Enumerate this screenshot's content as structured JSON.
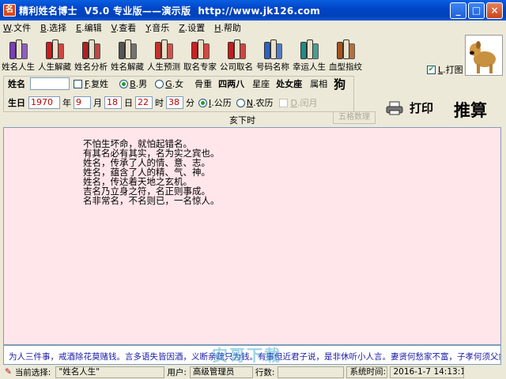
{
  "window": {
    "title": "精利姓名博士  V5.0 专业版——演示版  http://www.jk126.com",
    "minimize": "_",
    "maximize": "□",
    "close": "×"
  },
  "menu": [
    {
      "key": "W",
      "label": "文件"
    },
    {
      "key": "B",
      "label": "选择"
    },
    {
      "key": "E",
      "label": "编辑"
    },
    {
      "key": "V",
      "label": "查看"
    },
    {
      "key": "Y",
      "label": "音乐"
    },
    {
      "key": "Z",
      "label": "设置"
    },
    {
      "key": "H",
      "label": "帮助"
    }
  ],
  "toolbar": [
    {
      "label": "姓名人生",
      "icon": "books-icon",
      "color": "#7a3fb5"
    },
    {
      "label": "人生解藏",
      "icon": "red-book-icon",
      "color": "#c81f1f"
    },
    {
      "label": "姓名分析",
      "icon": "open-book-icon",
      "color": "#b52020"
    },
    {
      "label": "姓名解藏",
      "icon": "book-stack-icon",
      "color": "#555555"
    },
    {
      "label": "人生预测",
      "icon": "color-books-icon",
      "color": "#c9302c"
    },
    {
      "label": "取名专家",
      "icon": "red-books-icon",
      "color": "#d02020"
    },
    {
      "label": "公司取名",
      "icon": "book-red-icon",
      "color": "#c41d1d"
    },
    {
      "label": "号码名称",
      "icon": "blue-books-icon",
      "color": "#2b62c4"
    },
    {
      "label": "幸运人生",
      "icon": "teal-book-icon",
      "color": "#1f8c85"
    },
    {
      "label": "血型指纹",
      "icon": "brown-book-icon",
      "color": "#a8521c"
    }
  ],
  "print_option": {
    "key": "L",
    "label": "打图",
    "checked": true
  },
  "form": {
    "name_label": "姓名",
    "name_value": "",
    "compound_key": "F",
    "compound_label": "复姓",
    "male_key": "B",
    "male_label": "男",
    "female_key": "G",
    "female_label": "女",
    "bone_weight_label": "骨重",
    "bone_weight_value": "四两八",
    "constellation_label": "星座",
    "constellation_value": "处女座",
    "zodiac_label": "属相",
    "zodiac_value": "狗",
    "birthday_label": "生日",
    "year": "1970",
    "year_unit": "年",
    "month": "9",
    "month_unit": "月",
    "day": "18",
    "day_unit": "日",
    "hour": "22",
    "hour_unit": "时",
    "minute": "38",
    "minute_unit": "分",
    "solar_key": "I",
    "solar_label": "公历",
    "lunar_key": "N",
    "lunar_label": "农历",
    "leap_key": "D",
    "leap_label": "闰月",
    "hour_name": "亥下时",
    "wuge_button": "五格数理"
  },
  "actions": {
    "print": "打印",
    "calculate": "推算"
  },
  "verse": [
    "不怕生坏命，就怕起错名。",
    "有其名必有其实，名为实之宾也。",
    "姓名，传承了人的情、意、志。",
    "姓名，蕴含了人的精、气、神。",
    "姓名，传达着天地之玄机。",
    "吉名乃立身之符，名正则事成。",
    "名非常名，不名则已，一名惊人。"
  ],
  "ticker": "为人三件事，戒酒除花莫赌钱。言多语失皆因酒，义断亲疏只为钱。有事但近君子说，是非休听小人言。妻贤何愁家不富，子孝何须父向前",
  "watermark": "安哥下载",
  "status": {
    "current_label": "当前选择:",
    "current_value": "\"姓名人生\"",
    "user_label": "用户:",
    "user_value": "高级管理员",
    "lines_label": "行数:",
    "lines_value": "",
    "time_label": "系统时间:",
    "time_value": "2016-1-7  14:13:16"
  },
  "colors": {
    "main_background": "#ffe6ea",
    "ticker_text": "#1a1aa8",
    "title_bar": "#0045c9",
    "input_text": "#c00000"
  }
}
